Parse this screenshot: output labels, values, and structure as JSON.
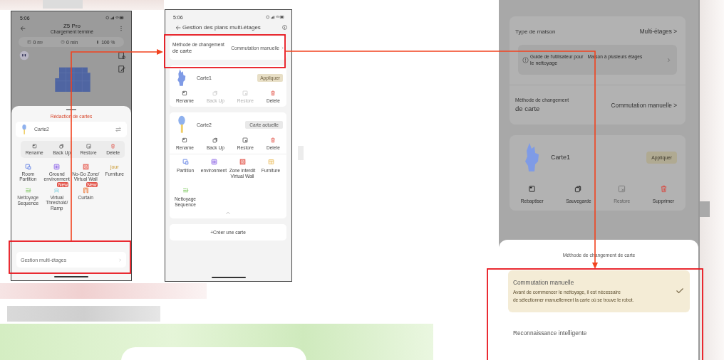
{
  "screen_map_editing": {
    "status_time": "5:06",
    "title": "Z5 Pro",
    "subtitle": "Chargement terminé",
    "stats": [
      {
        "kind": "area",
        "value": "0",
        "unit": "m²"
      },
      {
        "kind": "time",
        "value": "0",
        "unit": "min"
      },
      {
        "kind": "battery",
        "value": "100",
        "unit": "%"
      }
    ],
    "sheet_title": "Rédaction de cartes",
    "map_name": "Carte2",
    "actions": [
      {
        "kind": "rename",
        "label": "Rename",
        "disabled": false
      },
      {
        "kind": "backup",
        "label": "Back Up",
        "disabled": false
      },
      {
        "kind": "restore",
        "label": "Restore",
        "disabled": false
      },
      {
        "kind": "delete",
        "label": "Delete",
        "disabled": false
      }
    ],
    "tools": [
      {
        "kind": "partition",
        "label": "Room Partition"
      },
      {
        "kind": "ground",
        "label": "Ground environment"
      },
      {
        "kind": "nogo",
        "label": "No-Go Zone/ Virtual Wall"
      },
      {
        "kind": "furniture",
        "label": "Furniture",
        "icon_text": "jour"
      },
      {
        "kind": "sequence",
        "label": "Sequence",
        "note": "Nettoyage"
      },
      {
        "kind": "threshold",
        "label": "Virtual Threshold/ Ramp",
        "badge": "New"
      },
      {
        "kind": "curtain",
        "label": "Curtain",
        "badge": "New"
      }
    ],
    "footer": "Gestion multi-étages"
  },
  "screen_multi_floor": {
    "status_time": "5:06",
    "title": "Gestion des plans multi-étages",
    "method": {
      "label": "Méthode de changement",
      "label_line2": "de carte",
      "value": "Commutation manuelle"
    },
    "maps": [
      {
        "kind": "blob",
        "name": "Carte1",
        "current": false,
        "button": "Appliquer",
        "actions": [
          {
            "kind": "rename",
            "label": "Rename",
            "disabled": false
          },
          {
            "kind": "backup",
            "label": "Back Up",
            "disabled": true
          },
          {
            "kind": "restore",
            "label": "Restore",
            "disabled": true
          },
          {
            "kind": "delete",
            "label": "Delete",
            "disabled": false
          }
        ]
      },
      {
        "kind": "pin",
        "name": "Carte2",
        "current": true,
        "button": "Carte actuelle",
        "actions": [
          {
            "kind": "rename",
            "label": "Rename",
            "disabled": false
          },
          {
            "kind": "backup",
            "label": "Back Up",
            "disabled": false
          },
          {
            "kind": "restore",
            "label": "Restore",
            "disabled": false
          },
          {
            "kind": "delete",
            "label": "Delete",
            "disabled": false
          }
        ],
        "tools": [
          {
            "kind": "partition",
            "label": "Partition"
          },
          {
            "kind": "ground",
            "label": "environment"
          },
          {
            "kind": "nogo",
            "label": "Zone interdit Virtual Wall"
          },
          {
            "kind": "furniture",
            "label": "Furniture"
          },
          {
            "kind": "sequence",
            "label": "Nettoyage Sequence"
          }
        ]
      }
    ],
    "create_button": "+Créer une carte"
  },
  "screen_map_method": {
    "house_type": {
      "label": "Type de maison",
      "value": "Multi-étages >"
    },
    "guide": {
      "line1": "Guide de l'utilisateur pour",
      "line2": "le nettoyage",
      "value": "Maison à plusieurs étages"
    },
    "method": {
      "label": "Méthode de changement",
      "label_line2": "de carte",
      "value": "Commutation manuelle >"
    },
    "map": {
      "kind": "blob",
      "name": "Carte1",
      "button": "Appliquer",
      "actions": [
        {
          "kind": "rename",
          "label": "Rebaptiser",
          "disabled": false
        },
        {
          "kind": "backup",
          "label": "Sauvegarde",
          "disabled": false
        },
        {
          "kind": "restore",
          "label": "Restore",
          "disabled": true
        },
        {
          "kind": "delete",
          "label": "Supprimer",
          "disabled": false
        }
      ]
    },
    "sheet_title": "Méthode de changement de carte",
    "options": [
      {
        "title": "Commutation manuelle",
        "description": [
          "Avant de commencer le nettoyage, il est nécessaire",
          "de sélectionner manuellement la carte où se trouve le robot."
        ],
        "selected": true
      },
      {
        "title": "Reconnaissance intelligente",
        "selected": false
      }
    ]
  }
}
